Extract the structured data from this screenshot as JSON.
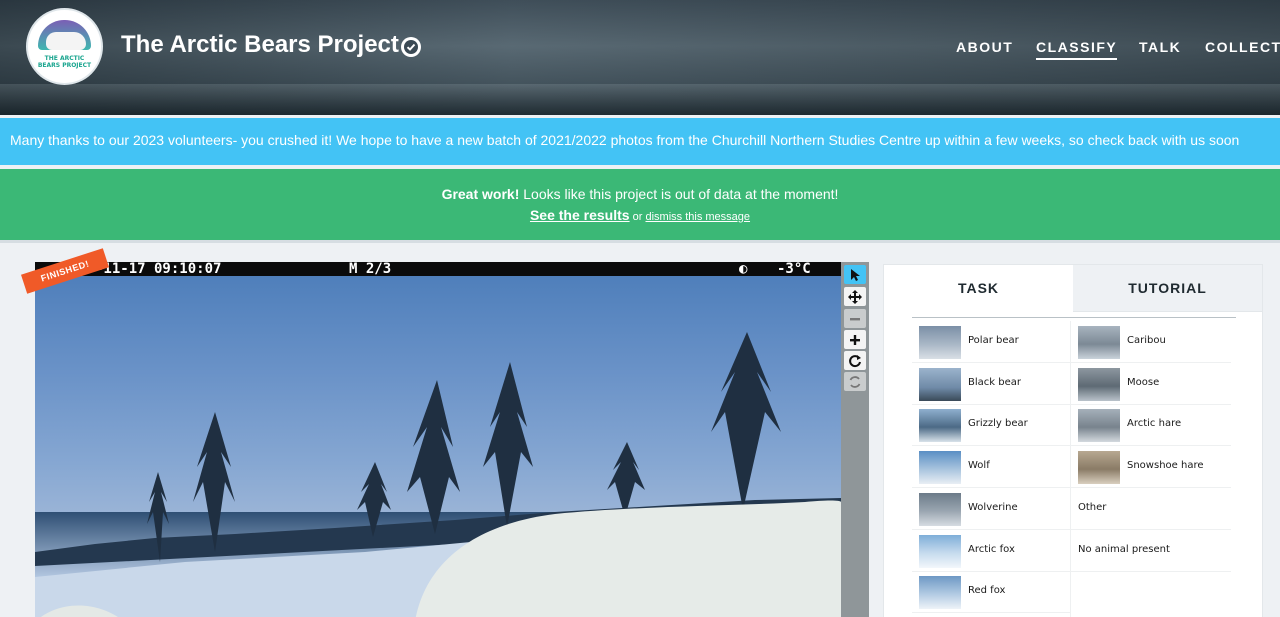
{
  "header": {
    "project_title": "The Arctic Bears Project",
    "logo_text": "THE ARCTIC BEARS PROJECT",
    "nav": [
      "ABOUT",
      "CLASSIFY",
      "TALK",
      "COLLECT"
    ],
    "active_nav": "CLASSIFY"
  },
  "announcement": "Many thanks to our 2023 volunteers- you crushed it! We hope to have a new batch of 2021/2022 photos from the Churchill Northern Studies Centre up within a few weeks, so check back with us soon",
  "finished_banner": {
    "bold": "Great work!",
    "message": " Looks like this project is out of data at the moment!",
    "results_link": "See the results",
    "or_text": " or ",
    "dismiss_link": "dismiss this message"
  },
  "subject": {
    "stamp_date": "-11-17 09:10:07",
    "stamp_mode": "M 2/3",
    "stamp_temp": "-3°C",
    "finished_label": "FINISHED!"
  },
  "toolbar_icons": [
    "pointer-icon",
    "move-icon",
    "zoom-out-icon",
    "zoom-in-icon",
    "rotate-icon",
    "reset-icon"
  ],
  "task_panel": {
    "tabs": [
      "TASK",
      "TUTORIAL"
    ],
    "choices_left": [
      "Polar bear",
      "Black bear",
      "Grizzly bear",
      "Wolf",
      "Wolverine",
      "Arctic fox",
      "Red fox"
    ],
    "choices_right": [
      "Caribou",
      "Moose",
      "Arctic hare",
      "Snowshoe hare",
      "Other",
      "No animal present"
    ]
  },
  "colors": {
    "announcement": "#43c3f5",
    "finished": "#3bb876",
    "finished_ribbon": "#f05a28"
  }
}
